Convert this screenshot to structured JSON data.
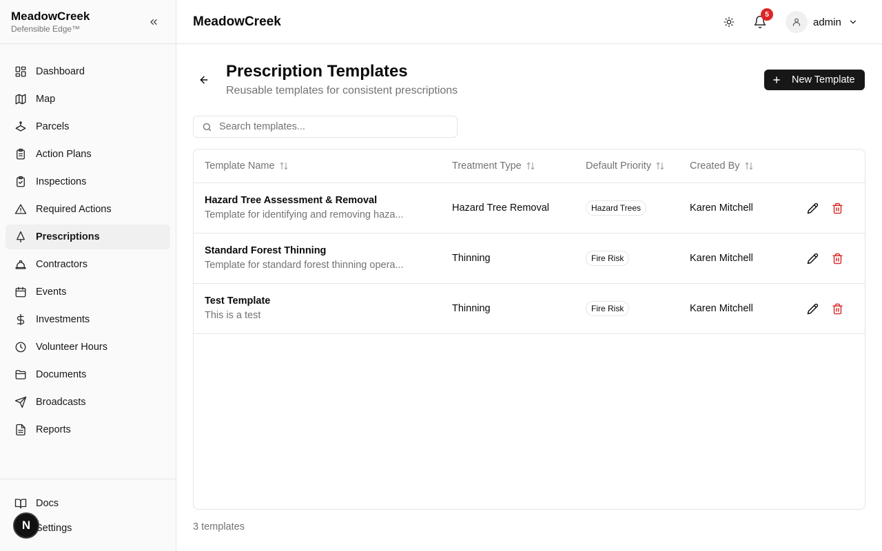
{
  "sidebar": {
    "brand_name": "MeadowCreek",
    "brand_sub": "Defensible Edge™",
    "items": [
      {
        "label": "Dashboard",
        "icon": "dashboard-icon"
      },
      {
        "label": "Map",
        "icon": "map-icon"
      },
      {
        "label": "Parcels",
        "icon": "parcels-icon"
      },
      {
        "label": "Action Plans",
        "icon": "clipboard-icon"
      },
      {
        "label": "Inspections",
        "icon": "clipboard-check-icon"
      },
      {
        "label": "Required Actions",
        "icon": "alert-triangle-icon"
      },
      {
        "label": "Prescriptions",
        "icon": "tree-icon",
        "active": true
      },
      {
        "label": "Contractors",
        "icon": "hard-hat-icon"
      },
      {
        "label": "Events",
        "icon": "calendar-icon"
      },
      {
        "label": "Investments",
        "icon": "dollar-icon"
      },
      {
        "label": "Volunteer Hours",
        "icon": "clock-icon"
      },
      {
        "label": "Documents",
        "icon": "folder-icon"
      },
      {
        "label": "Broadcasts",
        "icon": "send-icon"
      },
      {
        "label": "Reports",
        "icon": "file-text-icon"
      }
    ],
    "footer": {
      "docs_label": "Docs",
      "settings_label": "Settings",
      "badge_letter": "N"
    }
  },
  "header": {
    "title": "MeadowCreek",
    "notification_count": "5",
    "user_name": "admin"
  },
  "page": {
    "title": "Prescription Templates",
    "subtitle": "Reusable templates for consistent prescriptions",
    "new_button_label": "New Template",
    "search_placeholder": "Search templates..."
  },
  "table": {
    "columns": [
      "Template Name",
      "Treatment Type",
      "Default Priority",
      "Created By"
    ],
    "rows": [
      {
        "name": "Hazard Tree Assessment & Removal",
        "description": "Template for identifying and removing haza...",
        "treatment_type": "Hazard Tree Removal",
        "priority": "Hazard Trees",
        "created_by": "Karen Mitchell"
      },
      {
        "name": "Standard Forest Thinning",
        "description": "Template for standard forest thinning opera...",
        "treatment_type": "Thinning",
        "priority": "Fire Risk",
        "created_by": "Karen Mitchell"
      },
      {
        "name": "Test Template",
        "description": "This is a test",
        "treatment_type": "Thinning",
        "priority": "Fire Risk",
        "created_by": "Karen Mitchell"
      }
    ]
  },
  "footer_count": "3 templates",
  "colors": {
    "primary": "#171717",
    "danger": "#dc2626",
    "muted": "#737373",
    "border": "#e5e5e5"
  }
}
